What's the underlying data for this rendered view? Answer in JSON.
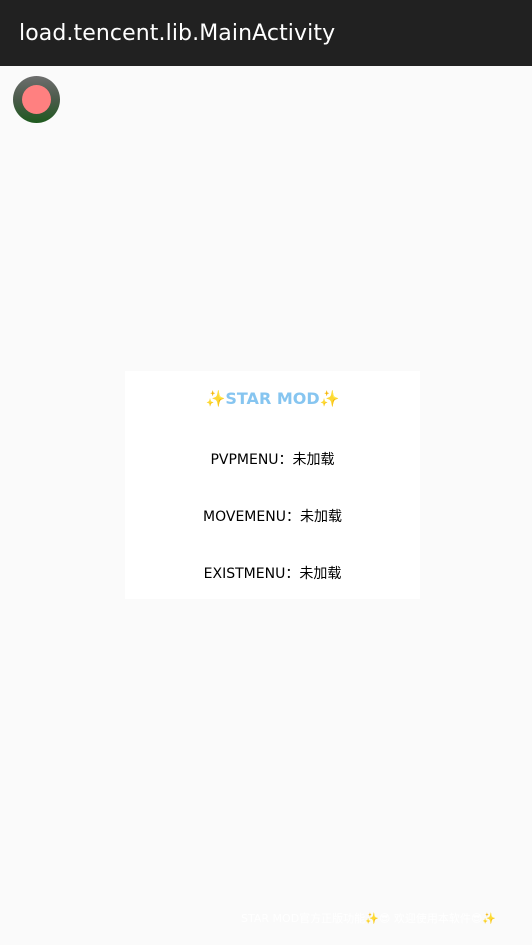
{
  "appbar": {
    "title": "load.tencent.lib.MainActivity"
  },
  "floating_button": {
    "icon": "record-icon",
    "outer_color": "#4a5a4a",
    "inner_color": "#ff8080"
  },
  "card": {
    "title": "STAR MOD",
    "title_decoration": "✨",
    "title_color": "#86c5f0",
    "rows": [
      {
        "label": "PVPMENU",
        "separator": "：",
        "status": "未加载"
      },
      {
        "label": "MOVEMENU",
        "separator": "：",
        "status": "未加载"
      },
      {
        "label": "EXISTMENU",
        "separator": "：",
        "status": "未加载"
      }
    ]
  },
  "footer": {
    "text": "STAR MOD官方正版功能✨😎 欢迎使用本软件😎✨"
  },
  "colors": {
    "appbar_bg": "#212121",
    "page_bg": "#fafafa",
    "card_bg": "#ffffff"
  }
}
